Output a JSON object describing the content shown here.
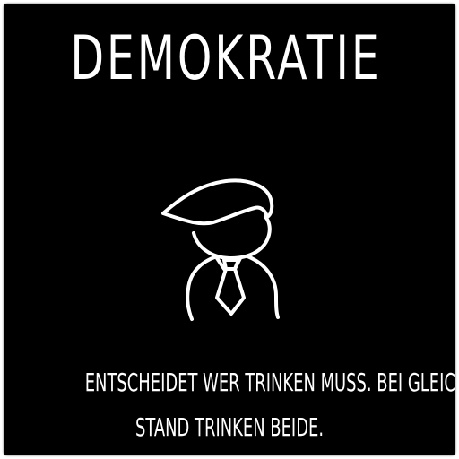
{
  "card": {
    "title": "DEMOKRATIE",
    "illustration_icon": "politician-with-tie-icon",
    "description_line1": "ENTSCHEIDET WER TRINKEN MUSS. BEI GLEICH-",
    "description_line2": "STAND TRINKEN BEIDE."
  },
  "colors": {
    "background": "#000000",
    "foreground": "#ffffff",
    "page": "#ffffff"
  }
}
